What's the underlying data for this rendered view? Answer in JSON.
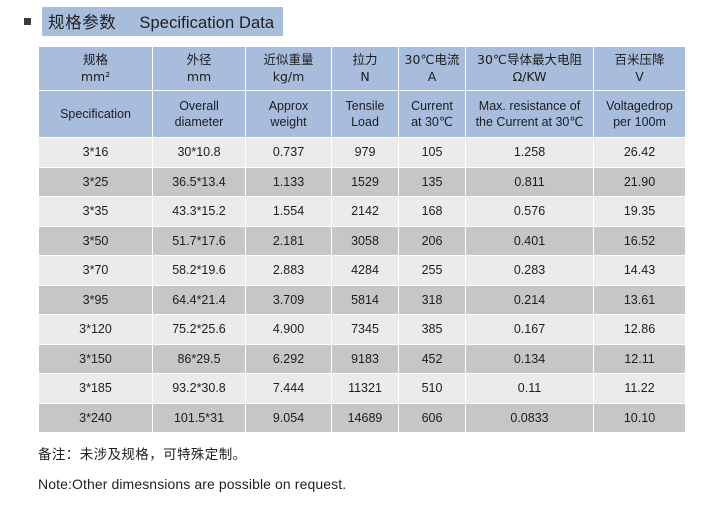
{
  "title": {
    "bullet_icon": "square-bullet-icon",
    "chinese": "规格参数",
    "english": "Specification Data"
  },
  "table": {
    "headers_cn": [
      {
        "line1": "规格",
        "line2": "mm²"
      },
      {
        "line1": "外径",
        "line2": "mm"
      },
      {
        "line1": "近似重量",
        "line2": "kg/m"
      },
      {
        "line1": "拉力",
        "line2": "N"
      },
      {
        "line1": "30℃电流",
        "line2": "A"
      },
      {
        "line1": "30℃导体最大电阻",
        "line2": "Ω/KW"
      },
      {
        "line1": "百米压降",
        "line2": "V"
      }
    ],
    "headers_en": [
      {
        "line1": "Specification",
        "line2": ""
      },
      {
        "line1": "Overall",
        "line2": "diameter"
      },
      {
        "line1": "Approx",
        "line2": "weight"
      },
      {
        "line1": "Tensile",
        "line2": "Load"
      },
      {
        "line1": "Current",
        "line2": "at 30℃"
      },
      {
        "line1": "Max. resistance of",
        "line2": "the Current at 30℃"
      },
      {
        "line1": "Voltagedrop",
        "line2": "per 100m"
      }
    ],
    "rows": [
      [
        "3*16",
        "30*10.8",
        "0.737",
        "979",
        "105",
        "1.258",
        "26.42"
      ],
      [
        "3*25",
        "36.5*13.4",
        "1.133",
        "1529",
        "135",
        "0.811",
        "21.90"
      ],
      [
        "3*35",
        "43.3*15.2",
        "1.554",
        "2142",
        "168",
        "0.576",
        "19.35"
      ],
      [
        "3*50",
        "51.7*17.6",
        "2.181",
        "3058",
        "206",
        "0.401",
        "16.52"
      ],
      [
        "3*70",
        "58.2*19.6",
        "2.883",
        "4284",
        "255",
        "0.283",
        "14.43"
      ],
      [
        "3*95",
        "64.4*21.4",
        "3.709",
        "5814",
        "318",
        "0.214",
        "13.61"
      ],
      [
        "3*120",
        "75.2*25.6",
        "4.900",
        "7345",
        "385",
        "0.167",
        "12.86"
      ],
      [
        "3*150",
        "86*29.5",
        "6.292",
        "9183",
        "452",
        "0.134",
        "12.11"
      ],
      [
        "3*185",
        "93.2*30.8",
        "7.444",
        "11321",
        "510",
        "0.11",
        "11.22"
      ],
      [
        "3*240",
        "101.5*31",
        "9.054",
        "14689",
        "606",
        "0.0833",
        "10.10"
      ]
    ]
  },
  "notes": {
    "chinese": "备注：未涉及规格，可特殊定制。",
    "english": "Note:Other dimesnsions are possible on request."
  },
  "colors": {
    "header_blue": "#a8bcdc",
    "row_light": "#ebebeb",
    "row_dark": "#c6c6c6",
    "text": "#1d1d1d",
    "background": "#ffffff"
  }
}
